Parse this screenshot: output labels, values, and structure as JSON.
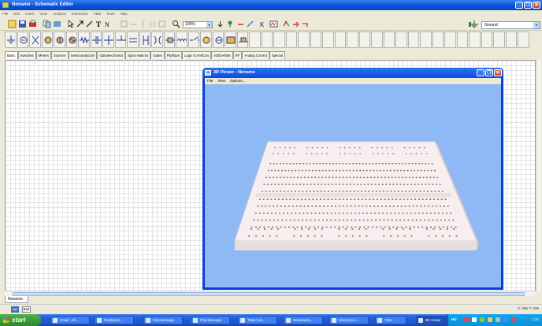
{
  "app": {
    "title": "Noname - Schematic Editor",
    "menu": [
      "File",
      "Edit",
      "Insert",
      "View",
      "Analysis",
      "Interactive",
      "T&M",
      "Tools",
      "Help"
    ]
  },
  "toolbar": {
    "zoom_value": "100%",
    "ground_value": "Ground",
    "dropdown_arrow": "▾"
  },
  "tabs": [
    "Basic",
    "Switches",
    "Meters",
    "Sources",
    "Semiconductors",
    "Optoelectronics",
    "Spice Macros",
    "Gates",
    "Flipflops",
    "Logic ICs-MCUs",
    "AD/DA/555",
    "RF",
    "Analog Control",
    "Special"
  ],
  "document_tab": "Noname",
  "status": {
    "exit_label": "Exit",
    "coords": "X: 366 Y: 185"
  },
  "viewer": {
    "title": "3D Viewer - Noname",
    "icon_text": "3D",
    "menu": [
      "File",
      "View",
      "Options..."
    ]
  },
  "taskbar": {
    "start_label": "start",
    "tasks": [
      "Gmail - All ...",
      "Postboard...",
      "Find Message",
      "Find Message",
      "Total Com...",
      "Dokumentu...",
      "Electronic s...",
      "TINA",
      "3D Viewer"
    ],
    "language": "HU",
    "clock": "1:24"
  },
  "colors": {
    "canvas_bg": "#ffffff",
    "viewer_bg": "#8fb9f4",
    "board": "#f5ecec",
    "holes": "#8b6a6a",
    "xp_blue": "#245edb"
  }
}
